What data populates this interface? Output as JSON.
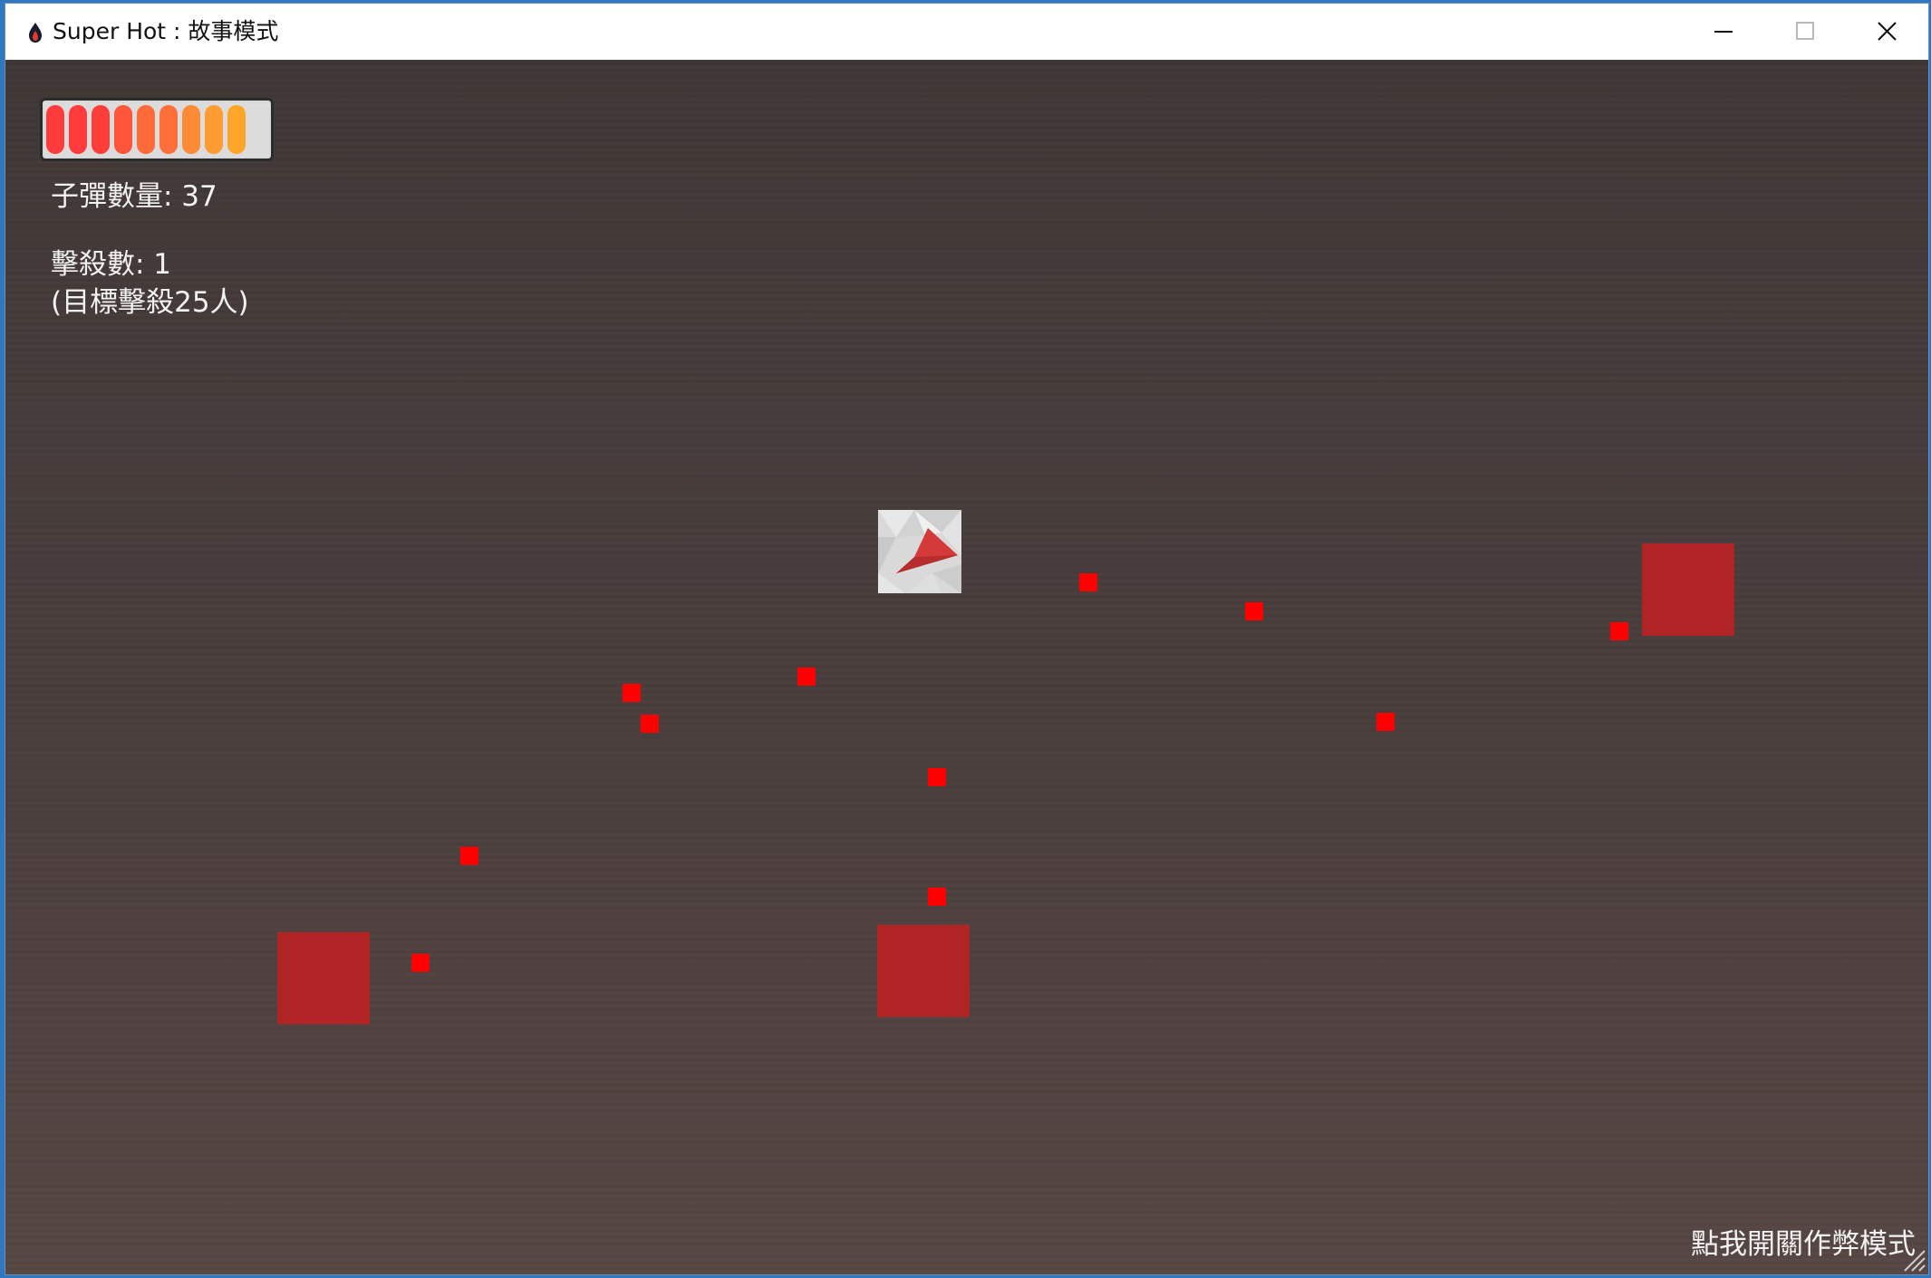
{
  "window": {
    "title": "Super Hot : 故事模式",
    "controls": [
      "minimize",
      "maximize",
      "close"
    ]
  },
  "hud": {
    "health": {
      "fraction": 0.9,
      "segments_filled": 9,
      "segment_colors": [
        "#ff3b3b",
        "#ff3b3b",
        "#ff3e3a",
        "#fe553a",
        "#fe6a38",
        "#fe6e38",
        "#fd8a34",
        "#fe9b31",
        "#fda528"
      ]
    },
    "ammo_text": "子彈數量: 37",
    "kills_text": "擊殺數: 1",
    "target_text": "(目標擊殺25人)"
  },
  "cheat_link": "點我開關作弊模式",
  "colors": {
    "enemy": "#b12426",
    "bullet": "#ff0000",
    "player_arrow": "#d43a3a"
  },
  "icons": {
    "app": "flame-icon",
    "player": "player-arrow-icon"
  }
}
